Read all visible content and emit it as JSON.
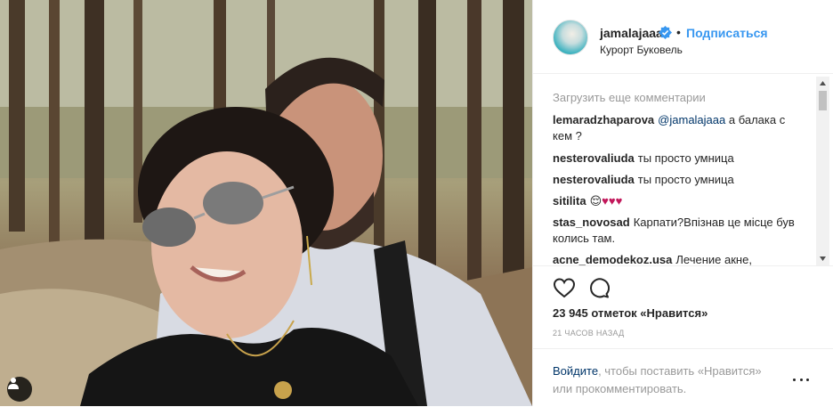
{
  "post": {
    "username": "jamalajaaa",
    "follow_label": "Подписаться",
    "separator": "•",
    "location": "Курорт Буковель",
    "load_more": "Загрузить еще комментарии",
    "comments": [
      {
        "user": "lemaradzhaparova",
        "mention": "@jamalajaaa",
        "text": "а балака с кем ?"
      },
      {
        "user": "nesterovaliuda",
        "mention": "",
        "text": "ты просто умница"
      },
      {
        "user": "nesterovaliuda",
        "mention": "",
        "text": "ты просто умница"
      },
      {
        "user": "sitilita",
        "mention": "",
        "text": "😌",
        "hearts": "♥♥♥"
      },
      {
        "user": "stas_novosad",
        "mention": "",
        "text": "Карпати?Впізнав це місце був колись там."
      },
      {
        "user": "acne_demodekoz.usa",
        "mention": "",
        "text": "Лечение акне,"
      }
    ],
    "likes": "23 945 отметок «Нравится»",
    "time": "21 ЧАСОВ НАЗАД",
    "login_link": "Войдите",
    "login_text": ", чтобы поставить «Нравится» или прокомментировать."
  },
  "colors": {
    "link": "#3897f0",
    "mention": "#003569",
    "muted": "#999999"
  },
  "icons": [
    "user-tag-icon",
    "verified-icon",
    "heart-icon",
    "comment-icon",
    "more-options-icon",
    "scroll-up-arrow-icon",
    "scroll-down-arrow-icon"
  ]
}
